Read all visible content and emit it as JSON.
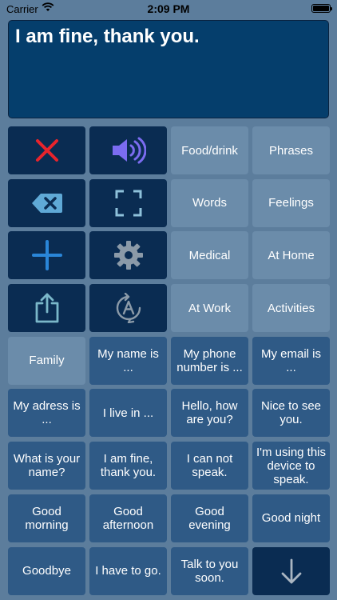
{
  "status_bar": {
    "carrier": "Carrier",
    "time": "2:09 PM"
  },
  "display": {
    "text": "I am fine, thank you."
  },
  "tools": [
    {
      "name": "clear",
      "icon": "close-icon"
    },
    {
      "name": "speak",
      "icon": "speaker-icon"
    },
    {
      "name": "delete",
      "icon": "backspace-icon"
    },
    {
      "name": "fullscreen",
      "icon": "fullscreen-icon"
    },
    {
      "name": "add",
      "icon": "plus-icon"
    },
    {
      "name": "settings",
      "icon": "gear-icon"
    },
    {
      "name": "share",
      "icon": "share-icon"
    },
    {
      "name": "autocomplete",
      "icon": "auto-text-icon"
    }
  ],
  "categories": [
    "Food/drink",
    "Phrases",
    "Words",
    "Feelings",
    "Medical",
    "At Home",
    "At Work",
    "Activities",
    "Family"
  ],
  "phrases": [
    "My name is ...",
    "My phone number is ...",
    "My email is ...",
    "My adress is ...",
    "I live in ...",
    "Hello, how are you?",
    "Nice to see you.",
    "What is your name?",
    "I am fine, thank you.",
    "I can not speak.",
    "I'm using this device to speak.",
    "Good morning",
    "Good afternoon",
    "Good evening",
    "Good night",
    "Goodbye",
    "I have to go.",
    "Talk to you soon."
  ],
  "scroll": {
    "icon": "arrow-down-icon"
  },
  "colors": {
    "background": "#5c7d9c",
    "display": "#053e6c",
    "tool_tile": "#0a2c52",
    "category_tile": "#6b8caa",
    "phrase_tile": "#2f5a86",
    "clear_red": "#e8242c",
    "speaker_purple": "#7b6cf0",
    "accent_blue": "#2a86d8",
    "icon_teal": "#7ab7c9"
  }
}
